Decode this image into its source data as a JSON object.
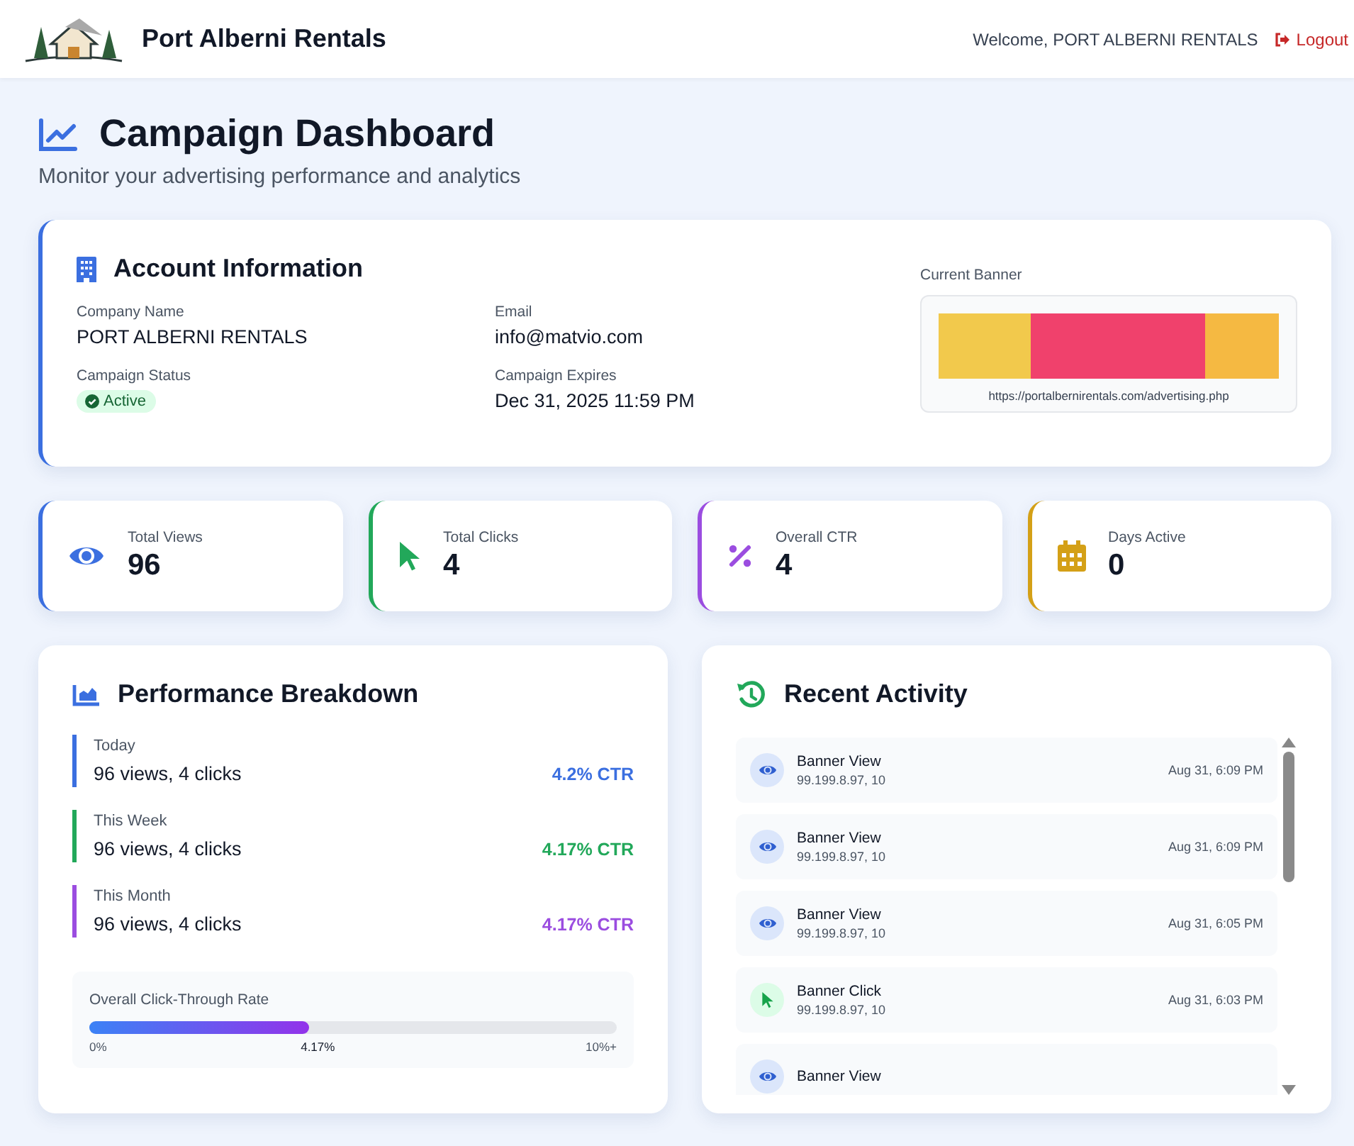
{
  "header": {
    "brand": "Port Alberni Rentals",
    "welcome": "Welcome, PORT ALBERNI RENTALS",
    "logout": "Logout"
  },
  "page": {
    "title": "Campaign Dashboard",
    "subtitle": "Monitor your advertising performance and analytics"
  },
  "account": {
    "title": "Account Information",
    "fields": [
      {
        "label": "Company Name",
        "value": "PORT ALBERNI RENTALS"
      },
      {
        "label": "Email",
        "value": "info@matvio.com"
      },
      {
        "label": "Campaign Status",
        "status": "Active",
        "kind": "badge"
      },
      {
        "label": "Campaign Expires",
        "value": "Dec 31, 2025 11:59 PM"
      }
    ],
    "banner": {
      "label": "Current Banner",
      "url": "https://portalbernirentals.com/advertising.php"
    }
  },
  "stats": [
    {
      "kind": "views",
      "label": "Total Views",
      "value": "96",
      "color": "#3b6fe0"
    },
    {
      "kind": "clicks",
      "label": "Total Clicks",
      "value": "4",
      "color": "#22a85a"
    },
    {
      "kind": "ctr",
      "label": "Overall CTR",
      "value": "4",
      "color": "#9b4de0"
    },
    {
      "kind": "days",
      "label": "Days Active",
      "value": "0",
      "color": "#d4a017"
    }
  ],
  "performance": {
    "title": "Performance Breakdown",
    "periods": [
      {
        "label": "Today",
        "summary": "96 views, 4 clicks",
        "ctr": "4.2% CTR",
        "color": "#3b6fe0"
      },
      {
        "label": "This Week",
        "summary": "96 views, 4 clicks",
        "ctr": "4.17% CTR",
        "color": "#22a85a"
      },
      {
        "label": "This Month",
        "summary": "96 views, 4 clicks",
        "ctr": "4.17% CTR",
        "color": "#9b4de0"
      }
    ],
    "overall": {
      "label": "Overall Click-Through Rate",
      "level": 0.417,
      "min": "0%",
      "reading": "4.17%",
      "max": "10%+"
    }
  },
  "activity": {
    "title": "Recent Activity",
    "items": [
      {
        "kind": "view",
        "title": "Banner View",
        "ip": "99.199.8.97, 10",
        "time": "Aug 31, 6:09 PM"
      },
      {
        "kind": "view",
        "title": "Banner View",
        "ip": "99.199.8.97, 10",
        "time": "Aug 31, 6:09 PM"
      },
      {
        "kind": "view",
        "title": "Banner View",
        "ip": "99.199.8.97, 10",
        "time": "Aug 31, 6:05 PM"
      },
      {
        "kind": "click",
        "title": "Banner Click",
        "ip": "99.199.8.97, 10",
        "time": "Aug 31, 6:03 PM"
      },
      {
        "kind": "view",
        "title": "Banner View"
      }
    ]
  }
}
